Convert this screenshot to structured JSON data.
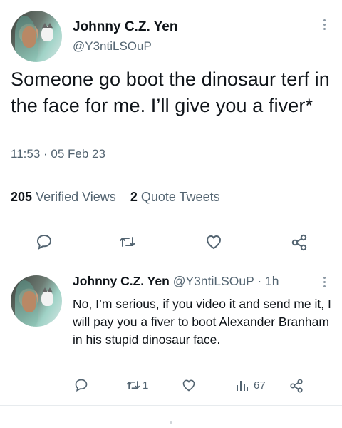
{
  "tweet": {
    "author_name": "Johnny C.Z. Yen",
    "author_handle": "@Y3ntiLSOuP",
    "text": "Someone go boot the dinosaur terf in the face for me. I’ll give you a fiver*",
    "timestamp": "11:53 · 05 Feb 23",
    "views_count": "205",
    "views_label": "Verified Views",
    "quotes_count": "2",
    "quotes_label": "Quote Tweets"
  },
  "reply": {
    "author_name": "Johnny C.Z. Yen",
    "author_handle": "@Y3ntiLSOuP",
    "age": "· 1h",
    "text": "No, I’m serious, if you video it and send me it, I will pay you a fiver to boot Alexander Branham in his stupid dinosaur face.",
    "retweets": "1",
    "views": "67"
  },
  "icons": [
    "more-icon",
    "reply-icon",
    "retweet-icon",
    "like-icon",
    "share-icon",
    "views-icon"
  ]
}
